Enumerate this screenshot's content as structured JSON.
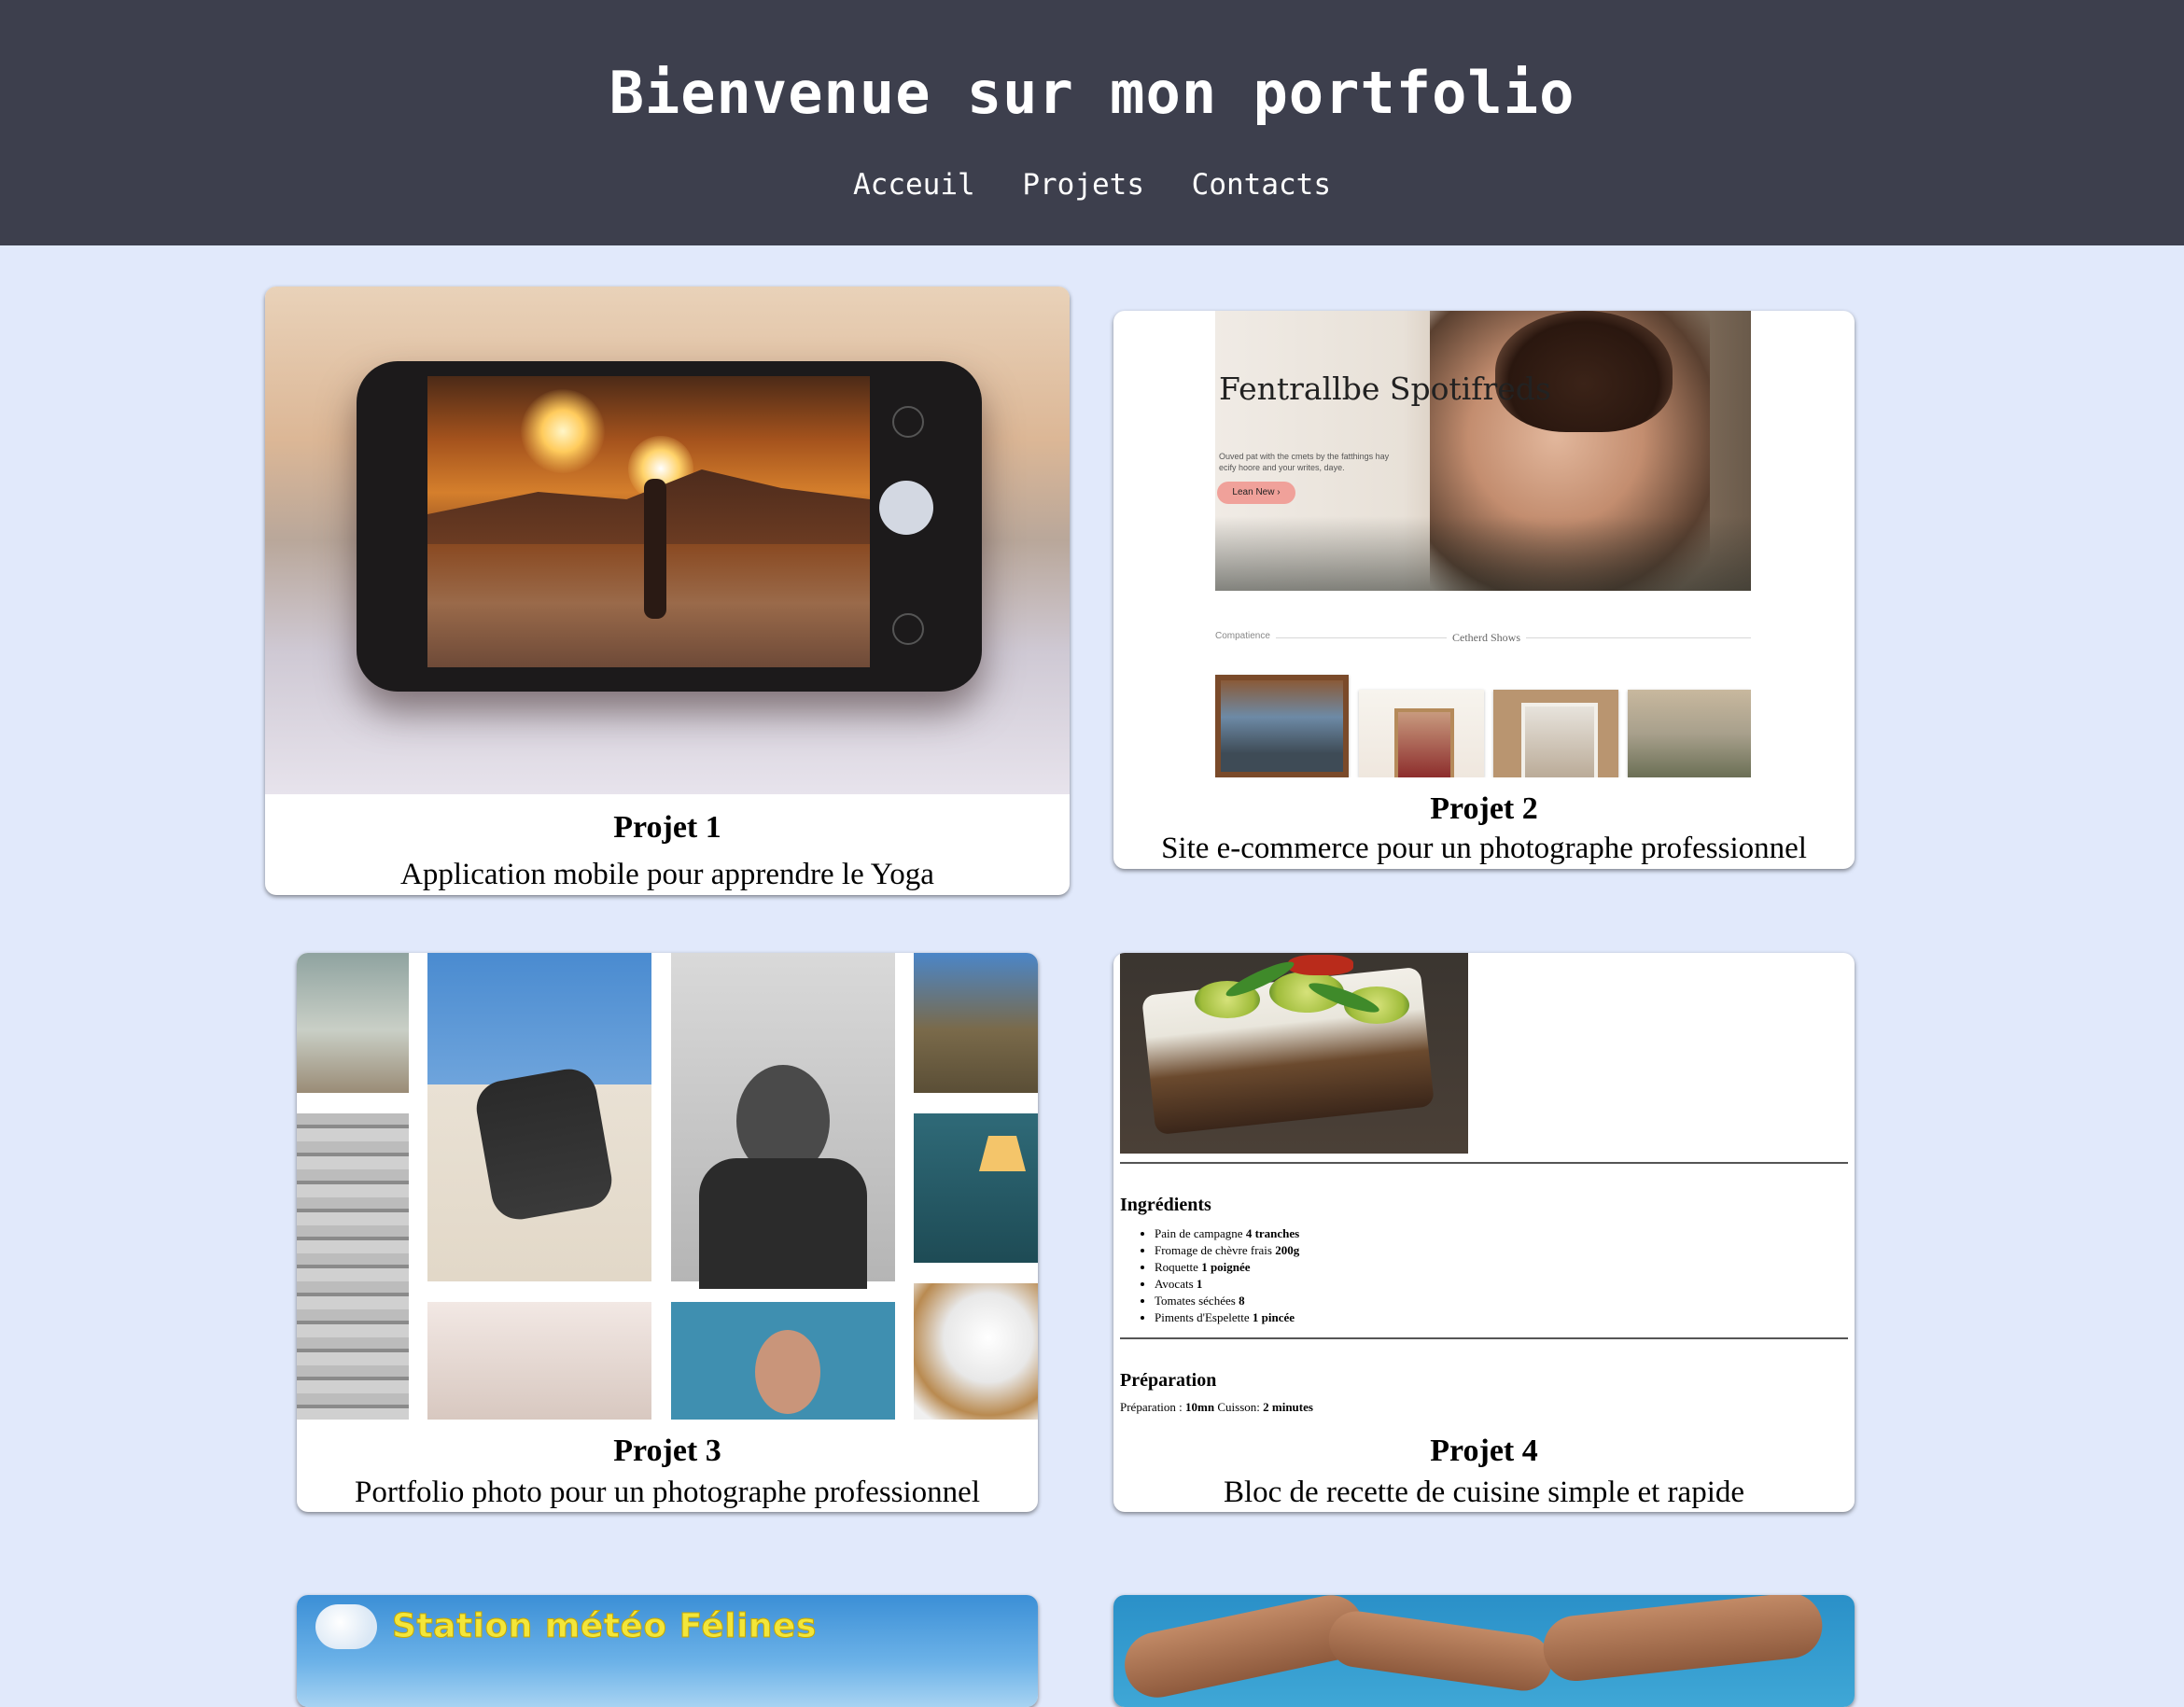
{
  "header": {
    "title": "Bienvenue sur mon portfolio",
    "nav": [
      "Acceuil",
      "Projets",
      "Contacts"
    ]
  },
  "projects": [
    {
      "title": "Projet 1",
      "description": "Application mobile pour apprendre le Yoga",
      "image": "yoga-phone-photo"
    },
    {
      "title": "Projet 2",
      "description": "Site e-commerce pour un photographe professionnel",
      "image": "photographer-site-screenshot",
      "screenshot_text": {
        "brand": "Fentrallbe Spotifreds",
        "tagline": "Ouved pat with the cmets by the fatthings hay ecify hoore and your writes, daye.",
        "cta": "Lean New ›",
        "section_left": "Compatience",
        "section_center": "Cetherd Shows"
      }
    },
    {
      "title": "Projet 3",
      "description": "Portfolio photo pour un photographe professionnel",
      "image": "photo-grid-collage"
    },
    {
      "title": "Projet 4",
      "description": "Bloc de recette de cuisine simple et rapide",
      "image": "recipe-block",
      "recipe": {
        "ingredients_heading": "Ingrédients",
        "ingredients": [
          {
            "name": "Pain de campagne",
            "qty": "4 tranches"
          },
          {
            "name": "Fromage de chèvre frais",
            "qty": "200g"
          },
          {
            "name": "Roquette",
            "qty": "1 poignée"
          },
          {
            "name": "Avocats",
            "qty": "1"
          },
          {
            "name": "Tomates séchées",
            "qty": "8"
          },
          {
            "name": "Piments d'Espelette",
            "qty": "1 pincée"
          }
        ],
        "preparation_heading": "Préparation",
        "prep_label": "Préparation :",
        "prep_time": "10mn",
        "cook_label": "Cuisson:",
        "cook_time": "2 minutes"
      }
    },
    {
      "title": "",
      "description": "",
      "image": "weather-station-banner",
      "banner_text": "Station météo Félines"
    },
    {
      "title": "",
      "description": "",
      "image": "hands-sky-photo"
    }
  ]
}
